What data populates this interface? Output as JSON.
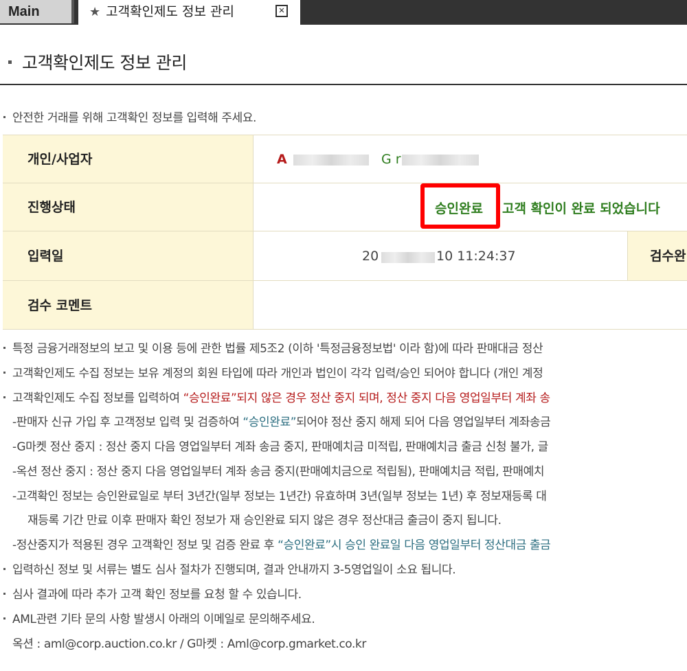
{
  "tabs": [
    {
      "label": "Main"
    },
    {
      "label": "고객확인제도 정보 관리"
    }
  ],
  "icons": {
    "tab_star": "star-icon",
    "tab_close": "close-icon"
  },
  "page_title": "고객확인제도 정보 관리",
  "intro": "안전한 거래를 위해 고객확인 정보를 입력해 주세요.",
  "table": {
    "row1": {
      "label": "개인/사업자",
      "value_a": "A",
      "value_g": "G r"
    },
    "row2": {
      "label": "진행상태",
      "status": "승인완료",
      "message": "고객 확인이 완료 되었습니다"
    },
    "row3": {
      "label": "입력일",
      "date_prefix": "20",
      "date_suffix": "10 11:24:37",
      "label2": "검수완"
    },
    "row4": {
      "label": "검수 코멘트",
      "value": ""
    }
  },
  "notices": {
    "n1": "특정 금융거래정보의 보고 및 이용 등에 관한 법률 제5조2 (이하 '특정금융정보법' 이라 함)에 따라 판매대금 정산 ",
    "n2": "고객확인제도 수집 정보는 보유 계정의 회원 타입에 따라 개인과 법인이 각각 입력/승인 되어야 합니다 (개인 계정",
    "n3_a": "고객확인제도 수집 정보를 입력하여 ",
    "n3_b": "“승인완료”되지 않은 경우 정산 중지 되며, 정산 중지 다음 영업일부터 계좌 송",
    "s1_a": "-판매자 신규 가입 후 고객정보 입력 및 검증하여 ",
    "s1_b": "“승인완료”",
    "s1_c": "되어야 정산 중지 해제 되어 다음 영업일부터 계좌송금",
    "s2": "-G마켓 정산 중지 : 정산 중지 다음 영업일부터 계좌 송금 중지, 판매예치금 미적립, 판매예치금 출금 신청 불가, 글",
    "s3": "-옥션 정산 중지 : 정산 중지 다음 영업일부터 계좌 송금 중지(판매예치금으로 적립됨), 판매예치금 적립, 판매예치",
    "s4": "-고객확인 정보는 승인완료일로 부터 3년간(일부 정보는 1년간) 유효하며 3년(일부 정보는 1년) 후 정보재등록 대",
    "s4_cont": "재등록 기간 만료 이후 판매자 확인 정보가 재 승인완료 되지 않은 경우 정산대금 출금이 중지 됩니다.",
    "s5_a": "-정산중지가 적용된 경우 고객확인 정보 및 검증 완료 후 ",
    "s5_b": "“승인완료”시 승인 완료일 다음 영업일부터 정산대금 출금",
    "n4": "입력하신 정보 및 서류는 별도 심사 절차가 진행되며, 결과 안내까지 3-5영업일이 소요 됩니다.",
    "n5": "심사 결과에 따라 추가 고객 확인 정보를 요청 할 수 있습니다.",
    "n6": "AML관련 기타 문의 사항 발생시 아래의 이메일로 문의해주세요.",
    "contact": "옥션 : aml@corp.auction.co.kr / G마켓 : Aml@corp.gmarket.co.kr"
  }
}
